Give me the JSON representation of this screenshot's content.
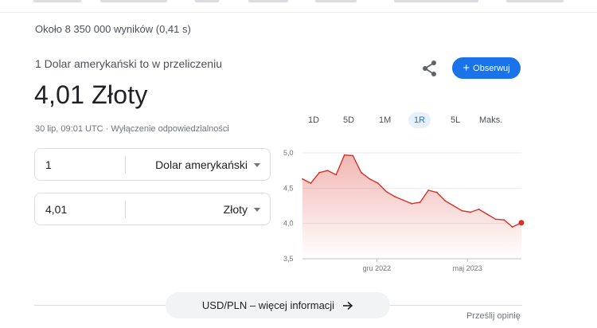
{
  "stats": "Około 8 350 000 wyników (0,41 s)",
  "converter": {
    "subtitle": "1 Dolar amerykański to w przeliczeniu",
    "main_value": "4,01 Złoty",
    "meta": "30 lip, 09:01 UTC · Wyłączenie odpowiedzialności",
    "follow_label": "Obserwuj",
    "from": {
      "amount": "1",
      "currency": "Dolar amerykański"
    },
    "to": {
      "amount": "4,01",
      "currency": "Złoty"
    }
  },
  "range_tabs": [
    {
      "label": "1D",
      "active": false
    },
    {
      "label": "5D",
      "active": false
    },
    {
      "label": "1M",
      "active": false
    },
    {
      "label": "1R",
      "active": true
    },
    {
      "label": "5L",
      "active": false
    },
    {
      "label": "Maks.",
      "active": false
    }
  ],
  "chart_data": {
    "type": "area",
    "title": "",
    "ylim": [
      3.5,
      5.0
    ],
    "yticks": [
      "5,0",
      "4,5",
      "4,0",
      "3,5"
    ],
    "xtick_labels": [
      "gru 2022",
      "maj 2023"
    ],
    "color": "#d93025",
    "series": [
      {
        "x": [
          "2022-07-30",
          "2022-08-13",
          "2022-08-27",
          "2022-09-10",
          "2022-09-24",
          "2022-10-08",
          "2022-10-22",
          "2022-11-05",
          "2022-11-19",
          "2022-12-03",
          "2022-12-17",
          "2022-12-31",
          "2023-01-14",
          "2023-01-28",
          "2023-02-11",
          "2023-02-25",
          "2023-03-11",
          "2023-03-25",
          "2023-04-08",
          "2023-04-22",
          "2023-05-06",
          "2023-05-20",
          "2023-06-03",
          "2023-06-17",
          "2023-07-01",
          "2023-07-15",
          "2023-07-30"
        ],
        "values": [
          4.63,
          4.57,
          4.72,
          4.75,
          4.69,
          4.97,
          4.96,
          4.72,
          4.63,
          4.57,
          4.45,
          4.38,
          4.33,
          4.28,
          4.3,
          4.47,
          4.44,
          4.32,
          4.25,
          4.18,
          4.16,
          4.2,
          4.13,
          4.06,
          4.05,
          3.95,
          4.01
        ]
      }
    ]
  },
  "more_info_label": "USD/PLN – więcej informacji",
  "feedback_label": "Prześlij opinię"
}
